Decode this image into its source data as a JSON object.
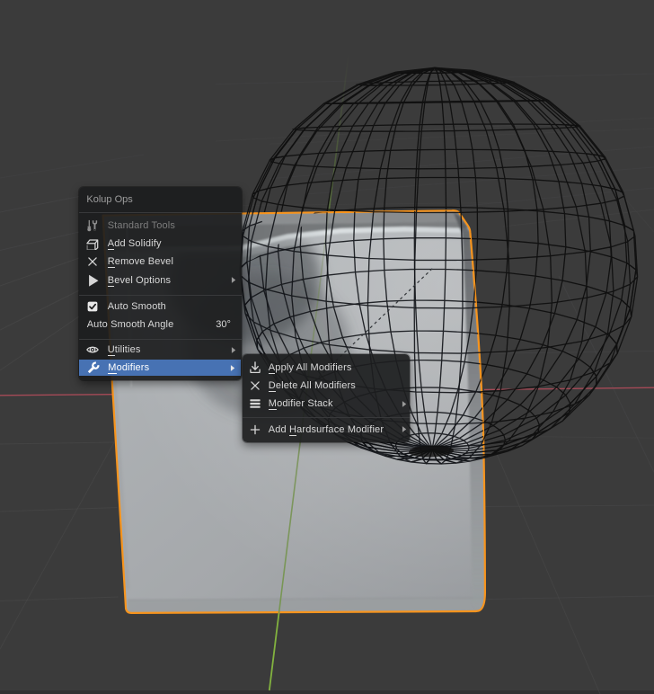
{
  "window": {
    "kind": "blender-3d-viewport"
  },
  "sphere_wire": {
    "f": 1000.0,
    "cx": 364.0,
    "D": 4.644482,
    "X0": 0.55010357,
    "Z0": -0.00842493,
    "Y0": 293.666462,
    "AX": -0.01388507,
    "AY": -0.17420366,
    "segments": 32,
    "rings": 16,
    "margin": 0.055
  },
  "colors": {
    "viewport_bg": "#3b3b3b",
    "menu_bg": "rgba(28,29,30,0.92)",
    "selected_blue": "#4772b3",
    "outline_orange": "#f7941d",
    "axis_red": "#a54a57",
    "axis_green": "#7cab3e",
    "text": "#d9d9d9",
    "text_disabled": "#7d7d7d",
    "title": "#9e9e9e"
  },
  "scene": {
    "objects": [
      "wireframe-uv-sphere",
      "beveled-cube-selected"
    ],
    "selected_outline": "#f7941d"
  },
  "context_menu": {
    "title": "Kolup Ops",
    "items": [
      {
        "label": "Standard Tools",
        "icon": "tool-icon",
        "disabled": true,
        "underline": -1
      },
      {
        "label": "Add Solidify",
        "icon": "solidify-icon",
        "underline": 0
      },
      {
        "label": "Remove Bevel",
        "icon": "x-icon",
        "underline": 0
      },
      {
        "label": "Bevel Options",
        "icon": "play-icon",
        "underline": 0,
        "submenu": true
      },
      {
        "label": "Auto Smooth",
        "icon": "checkbox-checked-icon",
        "underline": -1
      },
      {
        "label": "Auto Smooth Angle",
        "value": "30°",
        "underline": -1
      },
      {
        "label": "Utilities",
        "icon": "eye-icon",
        "underline": 0,
        "submenu": true
      },
      {
        "label": "Modifiers",
        "icon": "wrench-icon",
        "underline": 0,
        "submenu": true,
        "selected": true
      }
    ]
  },
  "submenu": {
    "items": [
      {
        "label": "Apply All Modifiers",
        "icon": "import-icon",
        "underline": 0
      },
      {
        "label": "Delete All Modifiers",
        "icon": "x-icon",
        "underline": 0
      },
      {
        "label": "Modifier Stack",
        "icon": "stack-icon",
        "underline": 0,
        "submenu": true
      },
      {
        "label": "Add Hardsurface Modifier",
        "icon": "plus-icon",
        "underline": 4,
        "submenu": true
      }
    ]
  }
}
